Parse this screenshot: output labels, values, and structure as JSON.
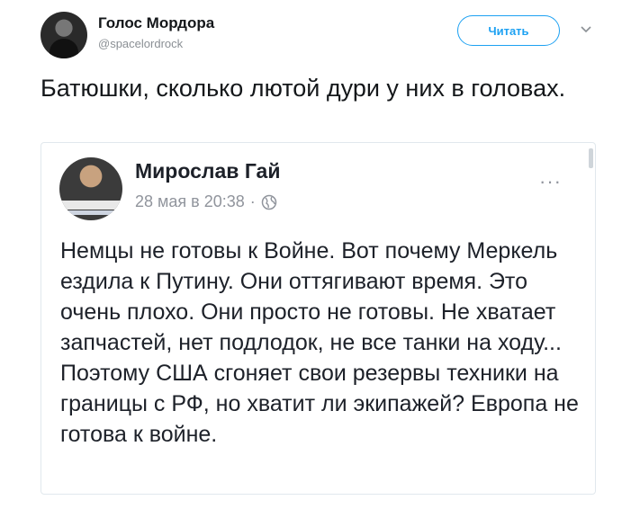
{
  "tweet": {
    "author_name": "Голос Мордора",
    "author_handle": "@spacelordrock",
    "follow_label": "Читать",
    "text": "Батюшки, сколько лютой дури у них в головах."
  },
  "embedded_post": {
    "author_name": "Мирослав Гай",
    "date": "28 мая в 20:38",
    "separator": "·",
    "more_label": "···",
    "text": "Немцы не готовы к Войне. Вот почему Меркель ездила к Путину. Они оттягивают время. Это очень плохо. Они просто не готовы. Не хватает запчастей, нет подлодок, не все танки на ходу... Поэтому США сгоняет свои резервы техники на границы с РФ, но хватит ли экипажей? Европа не готова к войне."
  },
  "colors": {
    "accent": "#1da1f2",
    "text": "#14171a",
    "muted": "#8a8f94",
    "card_border": "#e1e8ed"
  },
  "icons": {
    "caret": "chevron-down-icon",
    "globe": "globe-icon",
    "more": "more-options-icon"
  }
}
